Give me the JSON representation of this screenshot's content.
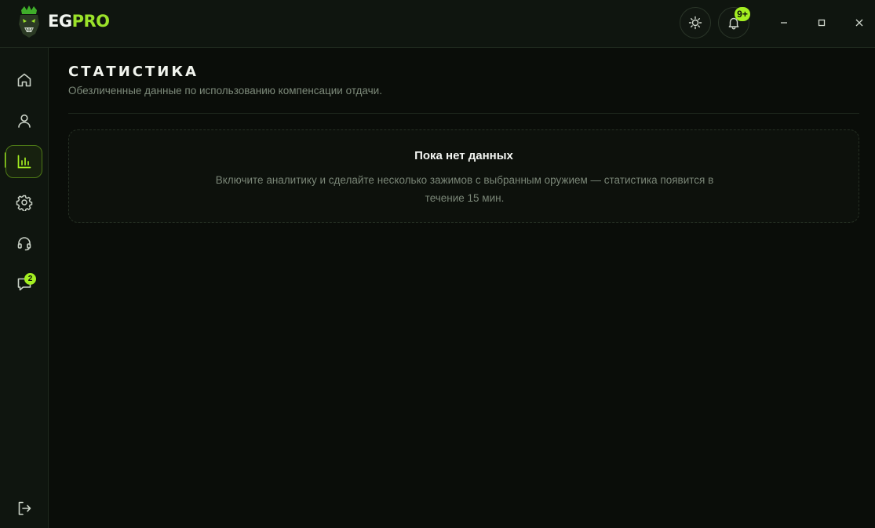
{
  "app": {
    "brand_part1": "EG",
    "brand_part2": "PRO",
    "accent_color": "#a3ee21"
  },
  "titlebar": {
    "theme_button_icon": "sun-icon",
    "notifications_icon": "bell-icon",
    "notifications_badge": "9+",
    "window_controls": [
      "minimize-icon",
      "maximize-icon",
      "close-icon"
    ]
  },
  "sidebar": {
    "items": [
      {
        "icon": "home-icon",
        "active": false
      },
      {
        "icon": "user-icon",
        "active": false
      },
      {
        "icon": "bar-chart-icon",
        "active": true
      },
      {
        "icon": "gear-icon",
        "active": false
      },
      {
        "icon": "headset-icon",
        "active": false
      },
      {
        "icon": "chat-icon",
        "active": false,
        "badge": "2"
      }
    ],
    "footer_icon": "logout-icon"
  },
  "page": {
    "title": "СТАТИСТИКА",
    "subtitle": "Обезличенные данные по использованию компенсации отдачи."
  },
  "empty_state": {
    "title": "Пока нет данных",
    "text": "Включите аналитику и сделайте несколько зажимов с выбранным оружием — статистика появится в течение 15 мин."
  }
}
